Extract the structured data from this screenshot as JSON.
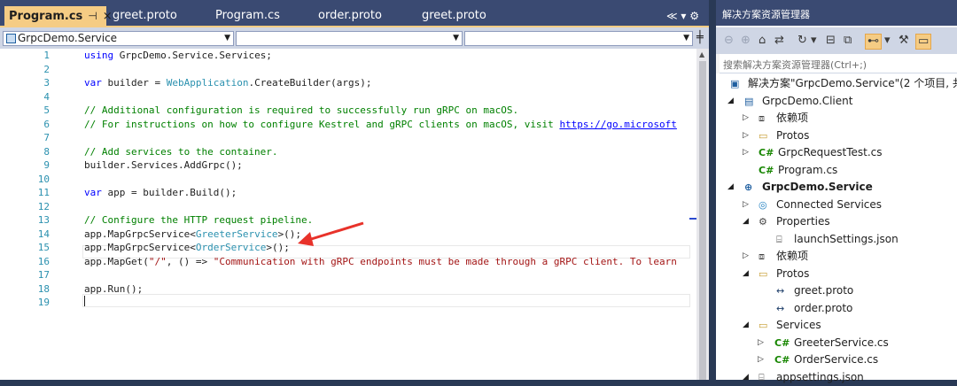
{
  "tabs": [
    {
      "label": "Program.cs",
      "active": true,
      "pin": "⊣",
      "close": "×"
    },
    {
      "label": "greet.proto"
    },
    {
      "label": "Program.cs"
    },
    {
      "label": "order.proto"
    },
    {
      "label": "greet.proto"
    }
  ],
  "tab_overflow": "≪ ▾ ⚙",
  "navbar": {
    "project": "GrpcDemo.Service",
    "member": "",
    "member2": ""
  },
  "code_lines": [
    {
      "n": "1",
      "t": ""
    },
    {
      "n": "2",
      "t": ""
    },
    {
      "n": "3",
      "t": ""
    },
    {
      "n": "4",
      "t": ""
    },
    {
      "n": "5",
      "t": ""
    },
    {
      "n": "6",
      "t": ""
    },
    {
      "n": "7",
      "t": ""
    },
    {
      "n": "8",
      "t": ""
    },
    {
      "n": "9",
      "t": ""
    },
    {
      "n": "10",
      "t": ""
    },
    {
      "n": "11",
      "t": ""
    },
    {
      "n": "12",
      "t": ""
    },
    {
      "n": "13",
      "t": ""
    },
    {
      "n": "14",
      "t": ""
    },
    {
      "n": "15",
      "t": ""
    },
    {
      "n": "16",
      "t": ""
    },
    {
      "n": "17",
      "t": ""
    },
    {
      "n": "18",
      "t": ""
    },
    {
      "n": "19",
      "t": ""
    }
  ],
  "code": {
    "l1": {
      "kw": "using",
      "rest": " GrpcDemo.Service.Services;"
    },
    "l3": {
      "kw": "var",
      "a": " builder = ",
      "ty": "WebApplication",
      "b": ".CreateBuilder(args);"
    },
    "l5": "// Additional configuration is required to successfully run gRPC on macOS.",
    "l6": {
      "c": "// For instructions on how to configure Kestrel and gRPC clients on macOS, visit ",
      "link": "https://go.microsoft"
    },
    "l8": "// Add services to the container.",
    "l9": "builder.Services.AddGrpc();",
    "l11": {
      "kw": "var",
      "rest": " app = builder.Build();"
    },
    "l13": "// Configure the HTTP request pipeline.",
    "l14": {
      "a": "app.MapGrpcService<",
      "ty": "GreeterService",
      "b": ">();"
    },
    "l15": {
      "a": "app.MapGrpcService<",
      "ty": "OrderService",
      "b": ">();"
    },
    "l16": {
      "a": "app.MapGet(",
      "s1": "\"/\"",
      "b": ", () => ",
      "s2": "\"Communication with gRPC endpoints must be made through a gRPC client. To learn"
    },
    "l18": "app.Run();"
  },
  "solution": {
    "title": "解决方案资源管理器",
    "search_placeholder": "搜索解决方案资源管理器(Ctrl+;)",
    "toolbar_icons": [
      "back-icon",
      "forward-icon",
      "home-icon",
      "switch-views-icon",
      "history-icon",
      "collapse-icon",
      "show-all-files-icon",
      "sync-icon",
      "properties-icon",
      "preview-icon"
    ],
    "nodes": [
      {
        "label": "解决方案\"GrpcDemo.Service\"(2 个项目, 共",
        "icon": "solution-icon",
        "exp": ""
      },
      {
        "label": "GrpcDemo.Client",
        "icon": "csproj-icon",
        "exp": "◢"
      },
      {
        "label": "依赖项",
        "icon": "dependencies-icon",
        "exp": "▷"
      },
      {
        "label": "Protos",
        "icon": "folder-icon",
        "exp": "▷"
      },
      {
        "label": "GrpcRequestTest.cs",
        "icon": "cs-file-icon",
        "exp": "▷"
      },
      {
        "label": "Program.cs",
        "icon": "cs-file-icon",
        "exp": ""
      },
      {
        "label": "GrpcDemo.Service",
        "icon": "web-project-icon",
        "exp": "◢"
      },
      {
        "label": "Connected Services",
        "icon": "connected-services-icon",
        "exp": "▷"
      },
      {
        "label": "Properties",
        "icon": "properties-folder-icon",
        "exp": "◢"
      },
      {
        "label": "launchSettings.json",
        "icon": "json-file-icon",
        "exp": ""
      },
      {
        "label": "依赖项",
        "icon": "dependencies-icon",
        "exp": "▷"
      },
      {
        "label": "Protos",
        "icon": "folder-open-icon",
        "exp": "◢"
      },
      {
        "label": "greet.proto",
        "icon": "proto-file-icon",
        "exp": ""
      },
      {
        "label": "order.proto",
        "icon": "proto-file-icon",
        "exp": ""
      },
      {
        "label": "Services",
        "icon": "folder-open-icon",
        "exp": "◢"
      },
      {
        "label": "GreeterService.cs",
        "icon": "cs-file-icon",
        "exp": "▷"
      },
      {
        "label": "OrderService.cs",
        "icon": "cs-file-icon",
        "exp": "▷"
      },
      {
        "label": "appsettings.json",
        "icon": "json-file-icon",
        "exp": "◢"
      }
    ]
  },
  "colors": {
    "accent_tab": "#f5cc84",
    "chrome": "#3a4a72",
    "annotation_arrow": "#e8322a"
  }
}
